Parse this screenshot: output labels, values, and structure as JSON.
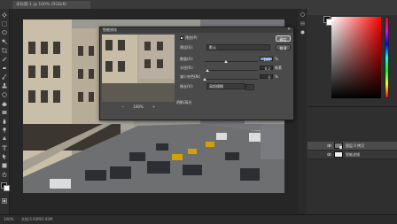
{
  "titlebar": {
    "tab_label": "未标题-1 @ 100% (RGB/8)"
  },
  "dialog": {
    "title": "智能锐化",
    "preview_label": "预览(P)",
    "preset_label": "预设(S):",
    "preset_value": "默认",
    "amount_label": "数量(A):",
    "amount_value": "100",
    "amount_unit": "%",
    "radius_label": "半径(R):",
    "radius_value": "0.2",
    "radius_unit": "像素",
    "noise_label": "减少杂色(N):",
    "noise_value": "0",
    "noise_unit": "%",
    "remove_label": "移去(V):",
    "remove_value": "高斯模糊",
    "ok_label": "确定",
    "cancel_label": "取消",
    "zoom_value": "100%",
    "zoom_out_symbol": "−",
    "zoom_in_symbol": "+",
    "section_label": "阴影/高光",
    "amount_level": 0.4,
    "radius_level": 0.05,
    "noise_level": 0.0
  },
  "status": {
    "left": "100%",
    "doc": "文档:5.93M/5.93M"
  },
  "layers": [
    {
      "name": "图层 0 拷贝"
    },
    {
      "name": "智能滤镜"
    }
  ],
  "colors": {
    "accent": "#6fa2e8",
    "panel": "#4a4a4a",
    "background": "#282828"
  }
}
